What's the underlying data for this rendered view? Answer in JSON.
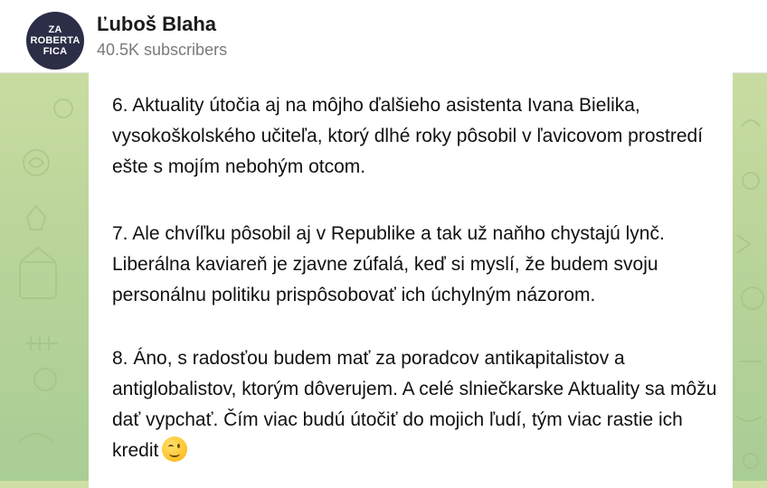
{
  "header": {
    "avatar_lines": [
      "ZA",
      "ROBERTA",
      "FICA"
    ],
    "channel_name": "Ľuboš Blaha",
    "subscribers": "40.5K subscribers"
  },
  "message": {
    "paragraphs": [
      "6. Aktuality útočia aj na môjho ďalšieho asistenta Ivana Bielika, vysokoškolského učiteľa, ktorý dlhé roky pôsobil v ľavicovom prostredí ešte s mojím nebohým otcom.",
      "7. Ale chvíľku pôsobil aj v Republike a tak už naňho chystajú lynč. Liberálna kaviareň je zjavne zúfalá, keď si myslí, že budem svoju personálnu politiku prispôsobovať ich úchylným názorom.",
      "8. Áno, s radosťou budem mať za poradcov antikapitalistov a antiglobalistov, ktorým dôverujem. A celé slniečkarske Aktuality sa môžu dať vypchať. Čím viac budú útočiť do mojich ľudí, tým viac rastie ich kredit"
    ],
    "emoji": "winking-face"
  },
  "colors": {
    "background_top": "#cfe0a6",
    "background_bottom": "#a9cd95",
    "avatar_bg": "#2c2d47"
  }
}
